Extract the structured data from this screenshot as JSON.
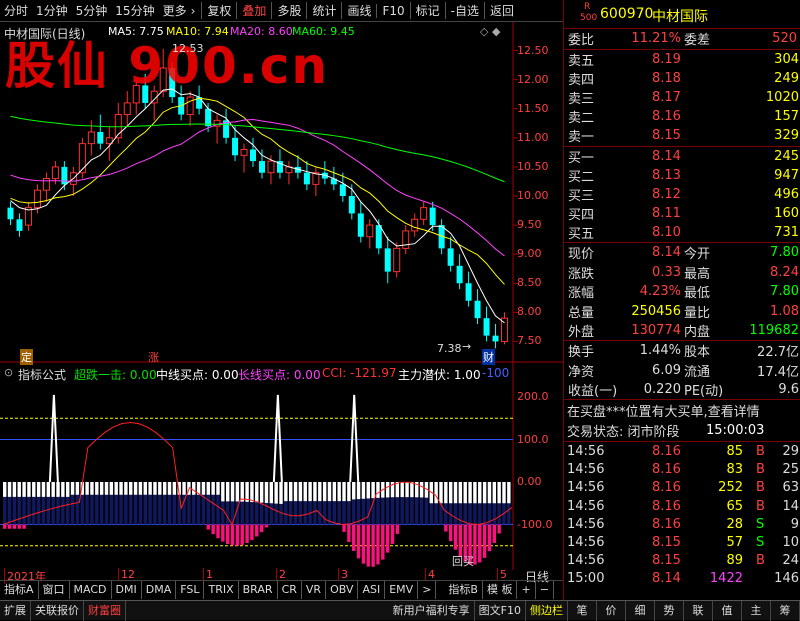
{
  "topbar": {
    "tabs": [
      "分时",
      "1分钟",
      "5分钟",
      "15分钟",
      "更多"
    ],
    "more_arrow": "›",
    "tools": [
      "复权",
      "叠加",
      "多股",
      "统计",
      "画线",
      "F10",
      "标记",
      "-自选",
      "返回"
    ],
    "active_tool": "叠加"
  },
  "watermark": "股仙 900.cn",
  "chart": {
    "title": "中材国际(日线)",
    "ma": [
      {
        "label": "MA5: 7.75",
        "color": "#ffffff"
      },
      {
        "label": "MA10: 7.94",
        "color": "#ffff00"
      },
      {
        "label": "MA20: 8.60",
        "color": "#ff40ff"
      },
      {
        "label": "MA60: 9.45",
        "color": "#00ff00"
      }
    ],
    "price_axis": [
      "12.50",
      "12.00",
      "11.50",
      "11.00",
      "10.50",
      "10.00",
      "9.50",
      "9.00",
      "8.50",
      "8.00",
      "7.50"
    ],
    "high_label": "12.53",
    "low_label": "7.38",
    "marker_ding": "定",
    "marker_zhang": "涨",
    "marker_cai": "财",
    "indicator_title": "指标公式",
    "indicator_values": [
      {
        "label": "超跌一击: 0.00",
        "color": "#00e000"
      },
      {
        "label": "中线买点: 0.00",
        "color": "#ffffff"
      },
      {
        "label": "长线买点: 0.00",
        "color": "#ff40ff"
      },
      {
        "label": "CCI: -121.97",
        "color": "#ff3030"
      },
      {
        "label": "主力潜伏: 1.00",
        "color": "#ffffff"
      },
      {
        "label": "-100",
        "color": "#4060ff"
      }
    ],
    "ind_axis": [
      "200.0",
      "100.0",
      "0.00",
      "-100.0"
    ],
    "buy_label": "回买",
    "date_axis": [
      "2021年",
      "12",
      "1",
      "2",
      "3",
      "4",
      "5"
    ],
    "period_label": "日线",
    "candles": [
      [
        9.8,
        9.9,
        9.5,
        9.6
      ],
      [
        9.6,
        9.7,
        9.3,
        9.4
      ],
      [
        9.5,
        9.9,
        9.4,
        9.8
      ],
      [
        9.8,
        10.2,
        9.7,
        10.1
      ],
      [
        10.1,
        10.4,
        9.9,
        10.3
      ],
      [
        10.3,
        10.6,
        10.2,
        10.5
      ],
      [
        10.5,
        10.6,
        10.1,
        10.2
      ],
      [
        10.2,
        10.5,
        10.0,
        10.4
      ],
      [
        10.4,
        11.0,
        10.3,
        10.9
      ],
      [
        10.9,
        11.3,
        10.7,
        11.1
      ],
      [
        11.1,
        11.4,
        10.8,
        10.9
      ],
      [
        10.9,
        11.2,
        10.6,
        11.0
      ],
      [
        11.0,
        11.6,
        10.9,
        11.4
      ],
      [
        11.4,
        11.8,
        11.2,
        11.6
      ],
      [
        11.6,
        12.0,
        11.4,
        11.9
      ],
      [
        11.9,
        12.1,
        11.5,
        11.6
      ],
      [
        11.6,
        11.9,
        11.3,
        11.8
      ],
      [
        11.8,
        12.53,
        11.7,
        12.2
      ],
      [
        12.2,
        12.3,
        11.6,
        11.7
      ],
      [
        11.7,
        11.9,
        11.3,
        11.4
      ],
      [
        11.4,
        11.8,
        11.2,
        11.7
      ],
      [
        11.7,
        11.9,
        11.4,
        11.5
      ],
      [
        11.5,
        11.6,
        11.1,
        11.2
      ],
      [
        11.2,
        11.4,
        10.9,
        11.3
      ],
      [
        11.3,
        11.5,
        10.9,
        11.0
      ],
      [
        11.0,
        11.2,
        10.6,
        10.7
      ],
      [
        10.7,
        10.9,
        10.4,
        10.8
      ],
      [
        10.8,
        11.0,
        10.5,
        10.6
      ],
      [
        10.6,
        10.8,
        10.3,
        10.4
      ],
      [
        10.4,
        10.7,
        10.2,
        10.6
      ],
      [
        10.6,
        10.8,
        10.3,
        10.4
      ],
      [
        10.4,
        10.6,
        10.2,
        10.5
      ],
      [
        10.5,
        10.7,
        10.3,
        10.4
      ],
      [
        10.4,
        10.6,
        10.1,
        10.2
      ],
      [
        10.2,
        10.5,
        10.0,
        10.4
      ],
      [
        10.4,
        10.6,
        10.2,
        10.3
      ],
      [
        10.3,
        10.5,
        10.1,
        10.2
      ],
      [
        10.2,
        10.4,
        9.9,
        10.0
      ],
      [
        10.0,
        10.2,
        9.6,
        9.7
      ],
      [
        9.7,
        9.9,
        9.2,
        9.3
      ],
      [
        9.3,
        9.6,
        9.1,
        9.5
      ],
      [
        9.5,
        9.6,
        9.0,
        9.1
      ],
      [
        9.1,
        9.3,
        8.5,
        8.7
      ],
      [
        8.7,
        9.2,
        8.6,
        9.1
      ],
      [
        9.1,
        9.5,
        9.0,
        9.4
      ],
      [
        9.4,
        9.7,
        9.3,
        9.6
      ],
      [
        9.6,
        9.9,
        9.5,
        9.8
      ],
      [
        9.8,
        9.9,
        9.4,
        9.5
      ],
      [
        9.5,
        9.6,
        9.0,
        9.1
      ],
      [
        9.1,
        9.3,
        8.7,
        8.8
      ],
      [
        8.8,
        9.0,
        8.4,
        8.5
      ],
      [
        8.5,
        8.7,
        8.1,
        8.2
      ],
      [
        8.2,
        8.4,
        7.8,
        7.9
      ],
      [
        7.9,
        8.1,
        7.5,
        7.6
      ],
      [
        7.6,
        7.8,
        7.38,
        7.5
      ],
      [
        7.5,
        8.0,
        7.45,
        7.9
      ]
    ]
  },
  "quote": {
    "code_prefix_top": "R",
    "code_prefix_bottom": "500",
    "code": "600970",
    "name": "中材国际",
    "webi_label": "委比",
    "webi_value": "11.21%",
    "wecha_label": "委差",
    "wecha_value": "520",
    "sells": [
      {
        "label": "卖五",
        "price": "8.19",
        "vol": "304"
      },
      {
        "label": "卖四",
        "price": "8.18",
        "vol": "249"
      },
      {
        "label": "卖三",
        "price": "8.17",
        "vol": "1020"
      },
      {
        "label": "卖二",
        "price": "8.16",
        "vol": "157"
      },
      {
        "label": "卖一",
        "price": "8.15",
        "vol": "329"
      }
    ],
    "buys": [
      {
        "label": "买一",
        "price": "8.14",
        "vol": "245"
      },
      {
        "label": "买二",
        "price": "8.13",
        "vol": "947"
      },
      {
        "label": "买三",
        "price": "8.12",
        "vol": "496"
      },
      {
        "label": "买四",
        "price": "8.11",
        "vol": "160"
      },
      {
        "label": "买五",
        "price": "8.10",
        "vol": "731"
      }
    ],
    "stats": [
      {
        "l1": "现价",
        "v1": "8.14",
        "c1": "#ff4040",
        "l2": "今开",
        "v2": "7.80",
        "c2": "#00ff00"
      },
      {
        "l1": "涨跌",
        "v1": "0.33",
        "c1": "#ff4040",
        "l2": "最高",
        "v2": "8.24",
        "c2": "#ff4040"
      },
      {
        "l1": "涨幅",
        "v1": "4.23%",
        "c1": "#ff4040",
        "l2": "最低",
        "v2": "7.80",
        "c2": "#00ff00"
      },
      {
        "l1": "总量",
        "v1": "250456",
        "c1": "#ffff00",
        "l2": "量比",
        "v2": "1.08",
        "c2": "#ff4040"
      },
      {
        "l1": "外盘",
        "v1": "130774",
        "c1": "#ff4040",
        "l2": "内盘",
        "v2": "119682",
        "c2": "#00ff00"
      }
    ],
    "fund": [
      {
        "l1": "换手",
        "v1": "1.44%",
        "l2": "股本",
        "v2": "22.7亿"
      },
      {
        "l1": "净资",
        "v1": "6.09",
        "l2": "流通",
        "v2": "17.4亿"
      },
      {
        "l1": "收益(一)",
        "v1": "0.220",
        "l2": "PE(动)",
        "v2": "9.6"
      }
    ],
    "notice": "在买盘***位置有大买单,查看详情",
    "status_label": "交易状态: 闭市阶段",
    "status_time": "15:00:03",
    "ticks": [
      {
        "t": "14:56",
        "p": "8.16",
        "v": "85",
        "s": "B",
        "n": "29"
      },
      {
        "t": "14:56",
        "p": "8.16",
        "v": "83",
        "s": "B",
        "n": "25"
      },
      {
        "t": "14:56",
        "p": "8.16",
        "v": "252",
        "s": "B",
        "n": "63"
      },
      {
        "t": "14:56",
        "p": "8.16",
        "v": "65",
        "s": "B",
        "n": "14"
      },
      {
        "t": "14:56",
        "p": "8.16",
        "v": "28",
        "s": "S",
        "n": "9"
      },
      {
        "t": "14:56",
        "p": "8.15",
        "v": "57",
        "s": "S",
        "n": "10"
      },
      {
        "t": "14:56",
        "p": "8.15",
        "v": "89",
        "s": "B",
        "n": "24"
      },
      {
        "t": "15:00",
        "p": "8.14",
        "v": "1422",
        "s": "",
        "n": "146"
      }
    ]
  },
  "bottomtabs": [
    "指标A",
    "窗口",
    "MACD",
    "DMI",
    "DMA",
    "FSL",
    "TRIX",
    "BRAR",
    "CR",
    "VR",
    "OBV",
    "ASI",
    "EMV",
    ">",
    "指标B",
    "模 板",
    "+",
    "−"
  ],
  "footer": {
    "left": [
      "扩展",
      "关联报价",
      "财富圈"
    ],
    "middle": [
      "新用户福利专享",
      "图文F10",
      "侧边栏"
    ],
    "right": [
      "笔",
      "价",
      "细",
      "势",
      "联",
      "值",
      "主",
      "筹"
    ]
  }
}
